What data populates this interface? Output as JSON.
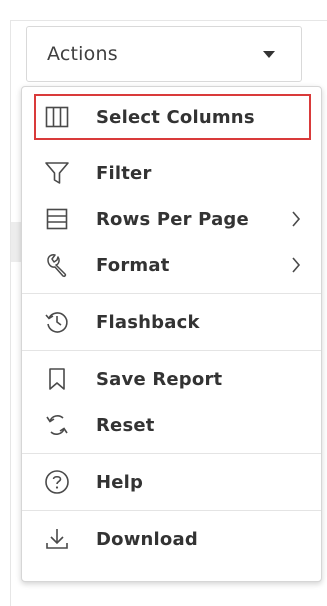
{
  "actions_button": {
    "label": "Actions",
    "caret_icon": "caret-down-icon"
  },
  "menu": {
    "items": [
      {
        "label": "Select Columns",
        "icon": "columns-icon",
        "selected": true
      },
      {
        "label": "Filter",
        "icon": "filter-icon"
      },
      {
        "label": "Rows Per Page",
        "icon": "rows-icon",
        "submenu": true
      },
      {
        "label": "Format",
        "icon": "wrench-icon",
        "submenu": true
      },
      {
        "label": "Flashback",
        "icon": "history-icon"
      },
      {
        "label": "Save Report",
        "icon": "bookmark-icon"
      },
      {
        "label": "Reset",
        "icon": "reset-icon"
      },
      {
        "label": "Help",
        "icon": "help-icon"
      },
      {
        "label": "Download",
        "icon": "download-icon"
      }
    ]
  },
  "colors": {
    "selection_outline": "#d93a3a",
    "text": "#333333",
    "icon": "#4a4a4a"
  }
}
